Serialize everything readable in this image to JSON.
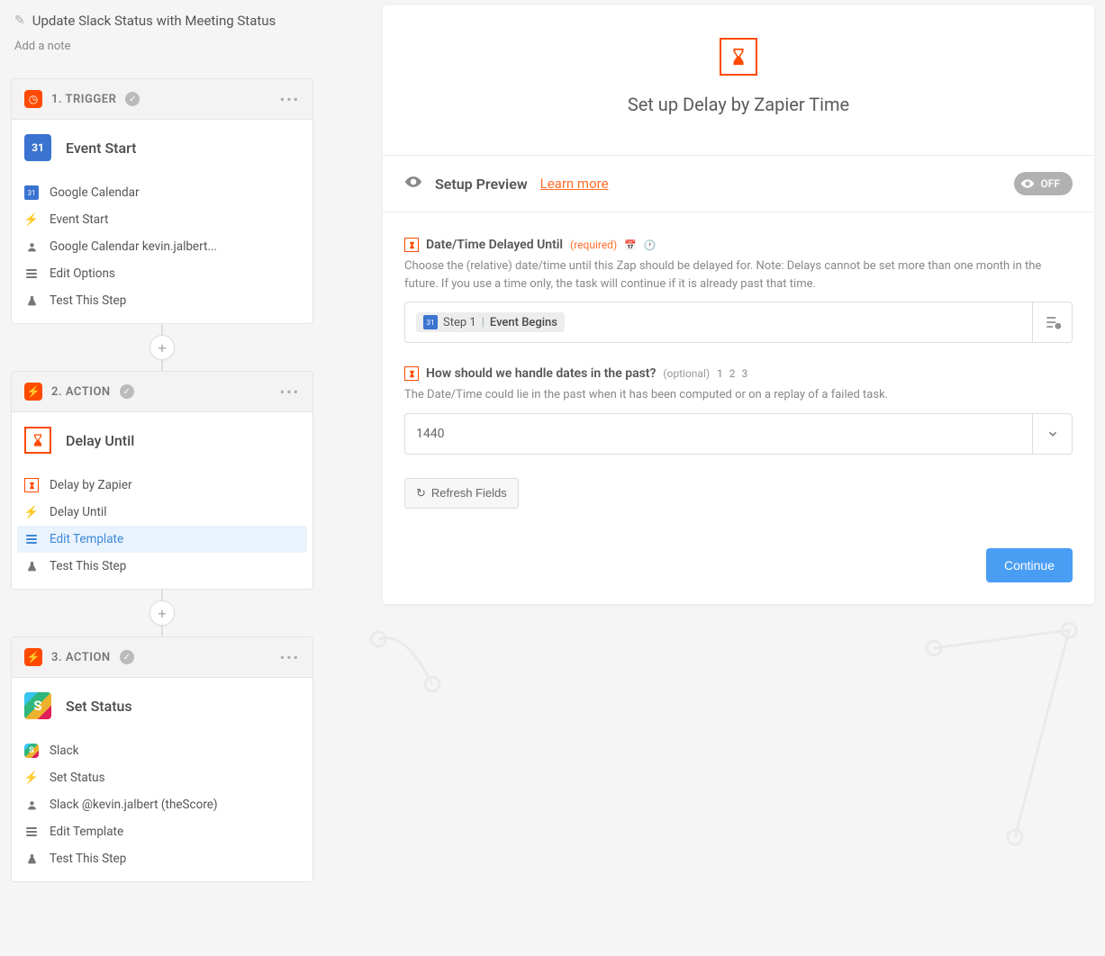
{
  "zap": {
    "title": "Update Slack Status with Meeting Status",
    "add_note": "Add a note"
  },
  "steps": [
    {
      "kind": "1. TRIGGER",
      "title": "Event Start",
      "items": [
        {
          "label": "Google Calendar",
          "icon": "gcal"
        },
        {
          "label": "Event Start",
          "icon": "bolt"
        },
        {
          "label": "Google Calendar kevin.jalbert...",
          "icon": "user"
        },
        {
          "label": "Edit Options",
          "icon": "list"
        },
        {
          "label": "Test This Step",
          "icon": "flask"
        }
      ]
    },
    {
      "kind": "2. ACTION",
      "title": "Delay Until",
      "items": [
        {
          "label": "Delay by Zapier",
          "icon": "delay"
        },
        {
          "label": "Delay Until",
          "icon": "bolt"
        },
        {
          "label": "Edit Template",
          "icon": "list",
          "active": true
        },
        {
          "label": "Test This Step",
          "icon": "flask"
        }
      ]
    },
    {
      "kind": "3. ACTION",
      "title": "Set Status",
      "items": [
        {
          "label": "Slack",
          "icon": "slack"
        },
        {
          "label": "Set Status",
          "icon": "bolt"
        },
        {
          "label": "Slack @kevin.jalbert (theScore)",
          "icon": "user"
        },
        {
          "label": "Edit Template",
          "icon": "list"
        },
        {
          "label": "Test This Step",
          "icon": "flask"
        }
      ]
    }
  ],
  "right": {
    "title": "Set up Delay by Zapier Time",
    "preview_label": "Setup Preview",
    "learn_more": "Learn more",
    "toggle": "OFF"
  },
  "fields": {
    "f1": {
      "label": "Date/Time Delayed Until",
      "required": "(required)",
      "help": "Choose the (relative) date/time until this Zap should be delayed for. Note: Delays cannot be set more than one month in the future. If you use a time only, the task will continue if it is already past that time.",
      "pill_step": "Step 1",
      "pill_val": "Event Begins"
    },
    "f2": {
      "label": "How should we handle dates in the past?",
      "optional": "(optional)",
      "nums": "1 2 3",
      "help": "The Date/Time could lie in the past when it has been computed or on a replay of a failed task.",
      "value": "1440"
    },
    "refresh": "Refresh Fields",
    "continue": "Continue"
  }
}
